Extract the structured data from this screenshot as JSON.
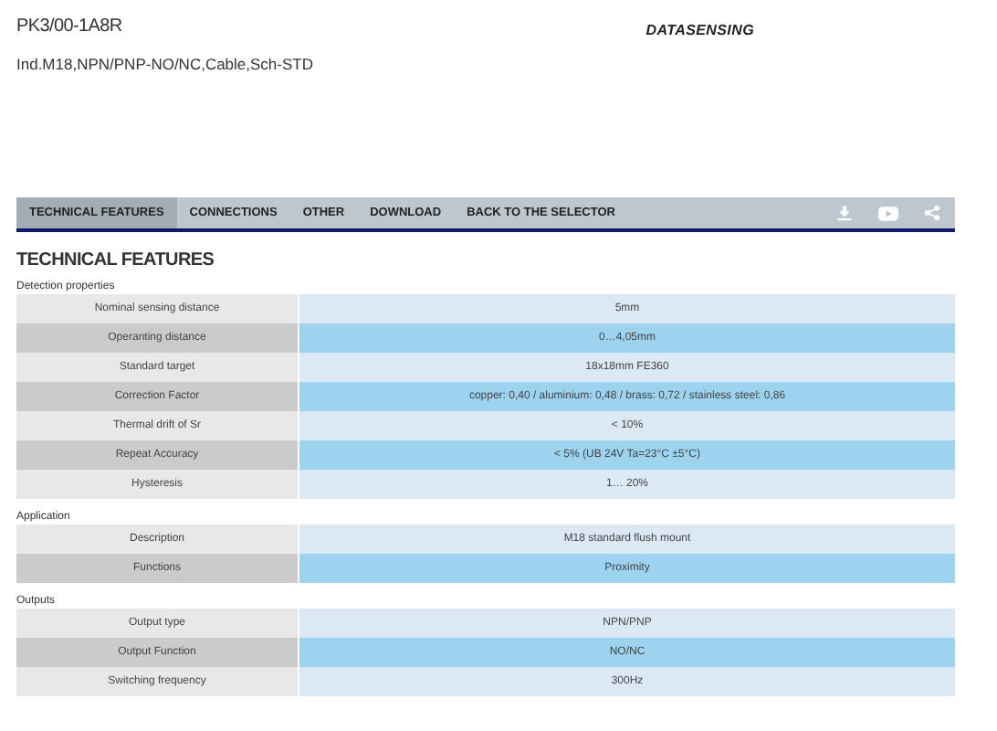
{
  "product": {
    "code": "PK3/00-1A8R",
    "description": "Ind.M18,NPN/PNP-NO/NC,Cable,Sch-STD",
    "logo": "DATASENSING"
  },
  "tabs": [
    {
      "label": "TECHNICAL FEATURES",
      "selected": true
    },
    {
      "label": "CONNECTIONS",
      "selected": false
    },
    {
      "label": "OTHER",
      "selected": false
    },
    {
      "label": "DOWNLOAD",
      "selected": false
    },
    {
      "label": "BACK TO THE SELECTOR",
      "selected": false
    }
  ],
  "heading": "TECHNICAL FEATURES",
  "sections": [
    {
      "title": "Detection properties",
      "rows": [
        {
          "label": "Nominal sensing distance",
          "value": "5mm"
        },
        {
          "label": "Operanting distance",
          "value": "0…4,05mm"
        },
        {
          "label": "Standard target",
          "value": "18x18mm FE360"
        },
        {
          "label": "Correction Factor",
          "value": "copper: 0,40 / aluminium: 0,48 / brass: 0,72 / stainless steel: 0,86"
        },
        {
          "label": "Thermal drift of Sr",
          "value": "< 10%"
        },
        {
          "label": "Repeat Accuracy",
          "value": "< 5% (UB 24V Ta=23°C ±5°C)"
        },
        {
          "label": "Hysteresis",
          "value": "1… 20%"
        }
      ]
    },
    {
      "title": "Application",
      "rows": [
        {
          "label": "Description",
          "value": "M18 standard flush mount"
        },
        {
          "label": "Functions",
          "value": "Proximity"
        }
      ]
    },
    {
      "title": "Outputs",
      "rows": [
        {
          "label": "Output type",
          "value": "NPN/PNP"
        },
        {
          "label": "Output Function",
          "value": "NO/NC"
        },
        {
          "label": "Switching frequency",
          "value": "300Hz"
        }
      ]
    }
  ]
}
